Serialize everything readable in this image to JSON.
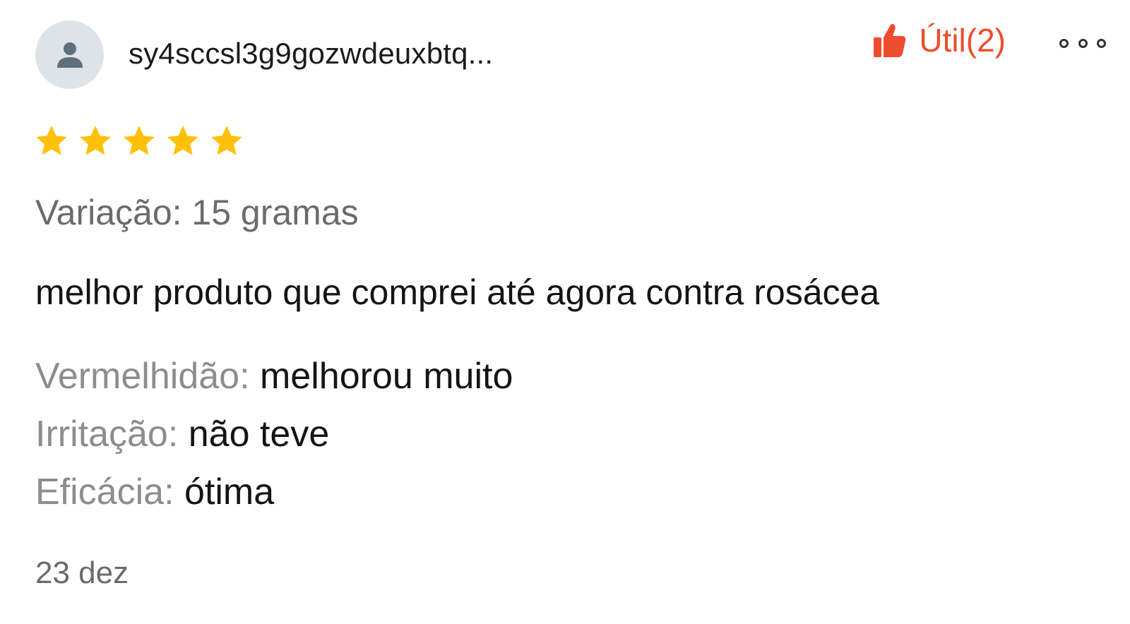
{
  "review": {
    "username": "sy4sccsl3g9gozwdeuxbtq...",
    "avatar_icon": "user-silhouette-icon",
    "helpful": {
      "label": "Útil(2)",
      "icon": "thumbs-up-icon",
      "color": "#ee4d2d"
    },
    "more_icon": "more-options-icon",
    "rating": {
      "value": 5,
      "max": 5,
      "star_color": "#ffc107"
    },
    "variation": "Variação: 15 gramas",
    "comment": "melhor produto que comprei até agora contra rosácea",
    "attributes": [
      {
        "label": "Vermelhidão:",
        "value": "melhorou muito"
      },
      {
        "label": "Irritação:",
        "value": "não teve"
      },
      {
        "label": "Eficácia:",
        "value": "ótima"
      }
    ],
    "date": "23 dez"
  }
}
